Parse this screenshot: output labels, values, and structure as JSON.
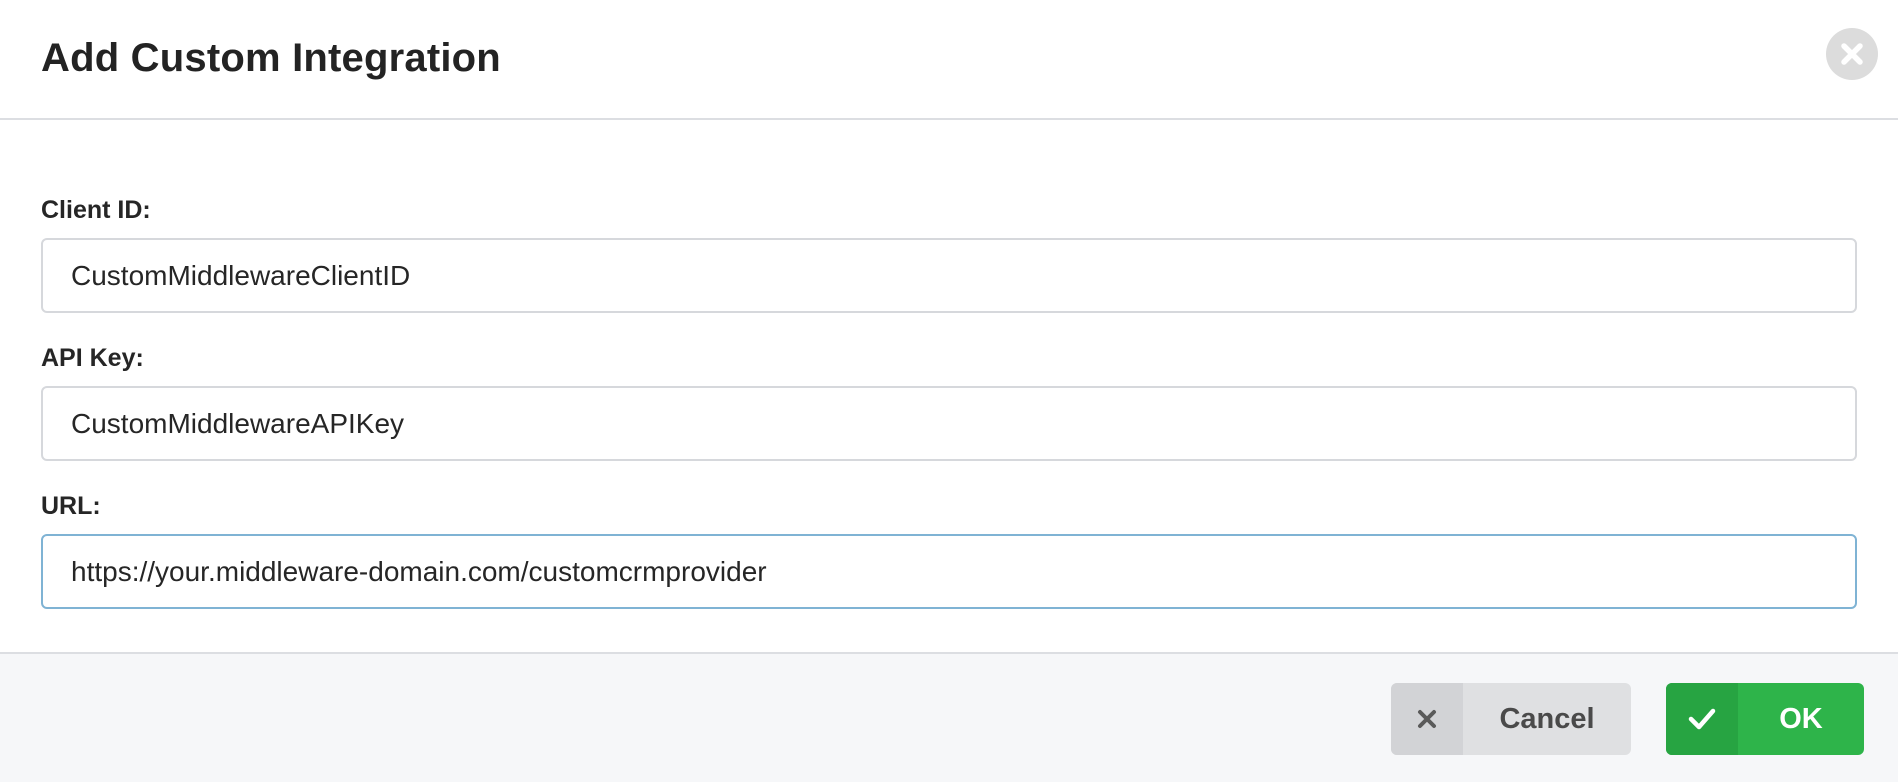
{
  "dialog": {
    "title": "Add Custom Integration"
  },
  "icons": {
    "close": "close-icon",
    "cancel": "x-icon",
    "ok": "checkmark-icon"
  },
  "colors": {
    "ok_button": "#2eb44a",
    "cancel_button": "#dfe0e2",
    "focus_border": "#7fb3d4"
  },
  "fields": {
    "client_id": {
      "label": "Client ID:",
      "value": "CustomMiddlewareClientID"
    },
    "api_key": {
      "label": "API Key:",
      "value": "CustomMiddlewareAPIKey"
    },
    "url": {
      "label": "URL:",
      "value": "https://your.middleware-domain.com/customcrmprovider"
    }
  },
  "footer": {
    "cancel_label": "Cancel",
    "ok_label": "OK"
  }
}
